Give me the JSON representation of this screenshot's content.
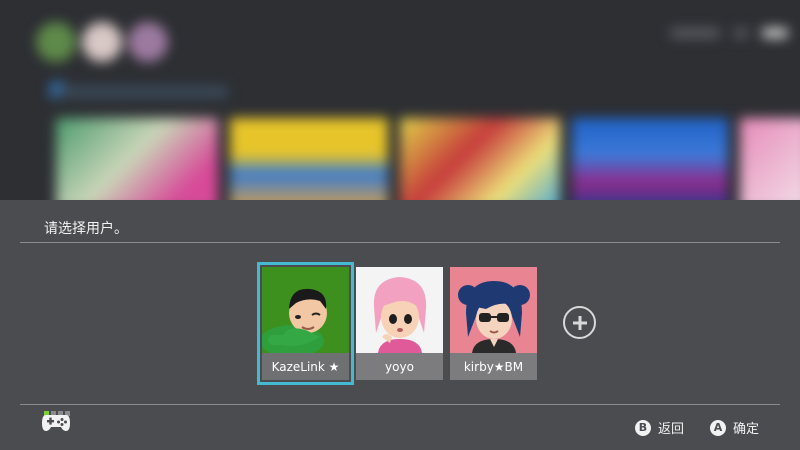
{
  "prompt": "请选择用户。",
  "users": [
    {
      "name": "KazeLink ★",
      "bg": "#3d8f1e",
      "selected": true
    },
    {
      "name": "yoyo",
      "bg": "#f4f4f4",
      "selected": false
    },
    {
      "name": "kirby★BM",
      "bg": "#e98592",
      "selected": false
    }
  ],
  "add_user_icon": "plus-icon",
  "footer": {
    "controller_icon": "controller-icon",
    "back": {
      "button": "B",
      "label": "返回"
    },
    "confirm": {
      "button": "A",
      "label": "确定"
    }
  },
  "colors": {
    "accent": "#45b9cf",
    "panel": "#4b4c4f",
    "indicator": "#7cd13a"
  }
}
